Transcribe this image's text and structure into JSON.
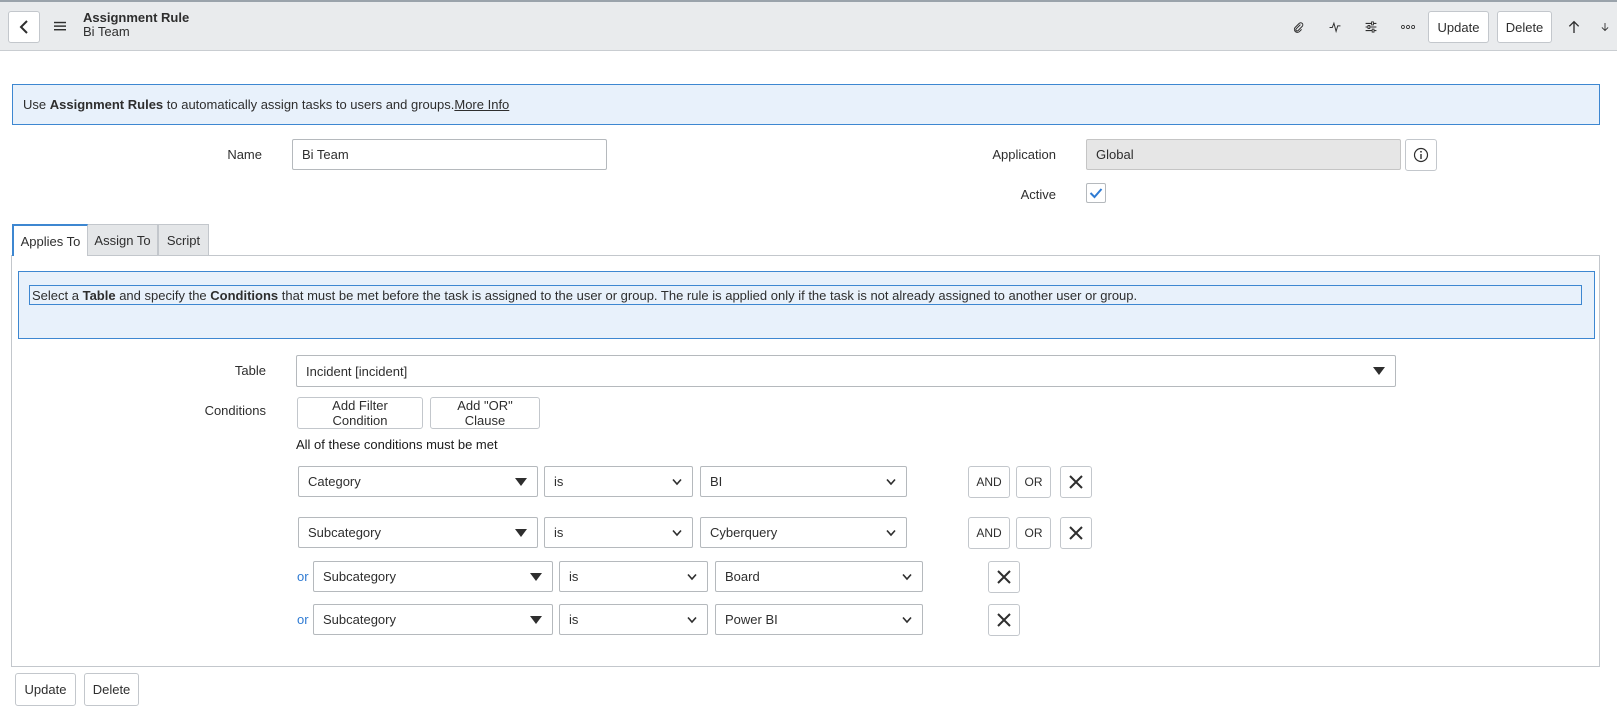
{
  "header": {
    "title": "Assignment Rule",
    "subtitle": "Bi Team",
    "update_label": "Update",
    "delete_label": "Delete"
  },
  "info": {
    "prefix": "Use ",
    "bold": "Assignment Rules",
    "suffix": " to automatically assign tasks to users and groups.",
    "link": "More Info"
  },
  "form": {
    "name_label": "Name",
    "name_value": "Bi Team",
    "application_label": "Application",
    "application_value": "Global",
    "active_label": "Active"
  },
  "tabs": [
    "Applies To",
    "Assign To",
    "Script"
  ],
  "applies": {
    "info_1": "Select a ",
    "info_bold_table": "Table",
    "info_2": " and specify the ",
    "info_bold_conditions": "Conditions",
    "info_3": " that must be met before the task is assigned to the user or group. The rule is applied only if the task is not already assigned to another user or group.",
    "table_label": "Table",
    "table_value": "Incident [incident]",
    "conditions_label": "Conditions",
    "add_filter_label": "Add Filter Condition",
    "add_or_label": "Add \"OR\" Clause",
    "all_conditions_text": "All of these conditions must be met",
    "conditions": [
      {
        "prefix": "",
        "field": "Category",
        "operator": "is",
        "value": "BI",
        "and": "AND",
        "or": "OR"
      },
      {
        "prefix": "",
        "field": "Subcategory",
        "operator": "is",
        "value": "Cyberquery",
        "and": "AND",
        "or": "OR"
      },
      {
        "prefix": "or",
        "field": "Subcategory",
        "operator": "is",
        "value": "Board"
      },
      {
        "prefix": "or",
        "field": "Subcategory",
        "operator": "is",
        "value": "Power BI"
      }
    ]
  },
  "footer": {
    "update_label": "Update",
    "delete_label": "Delete"
  }
}
